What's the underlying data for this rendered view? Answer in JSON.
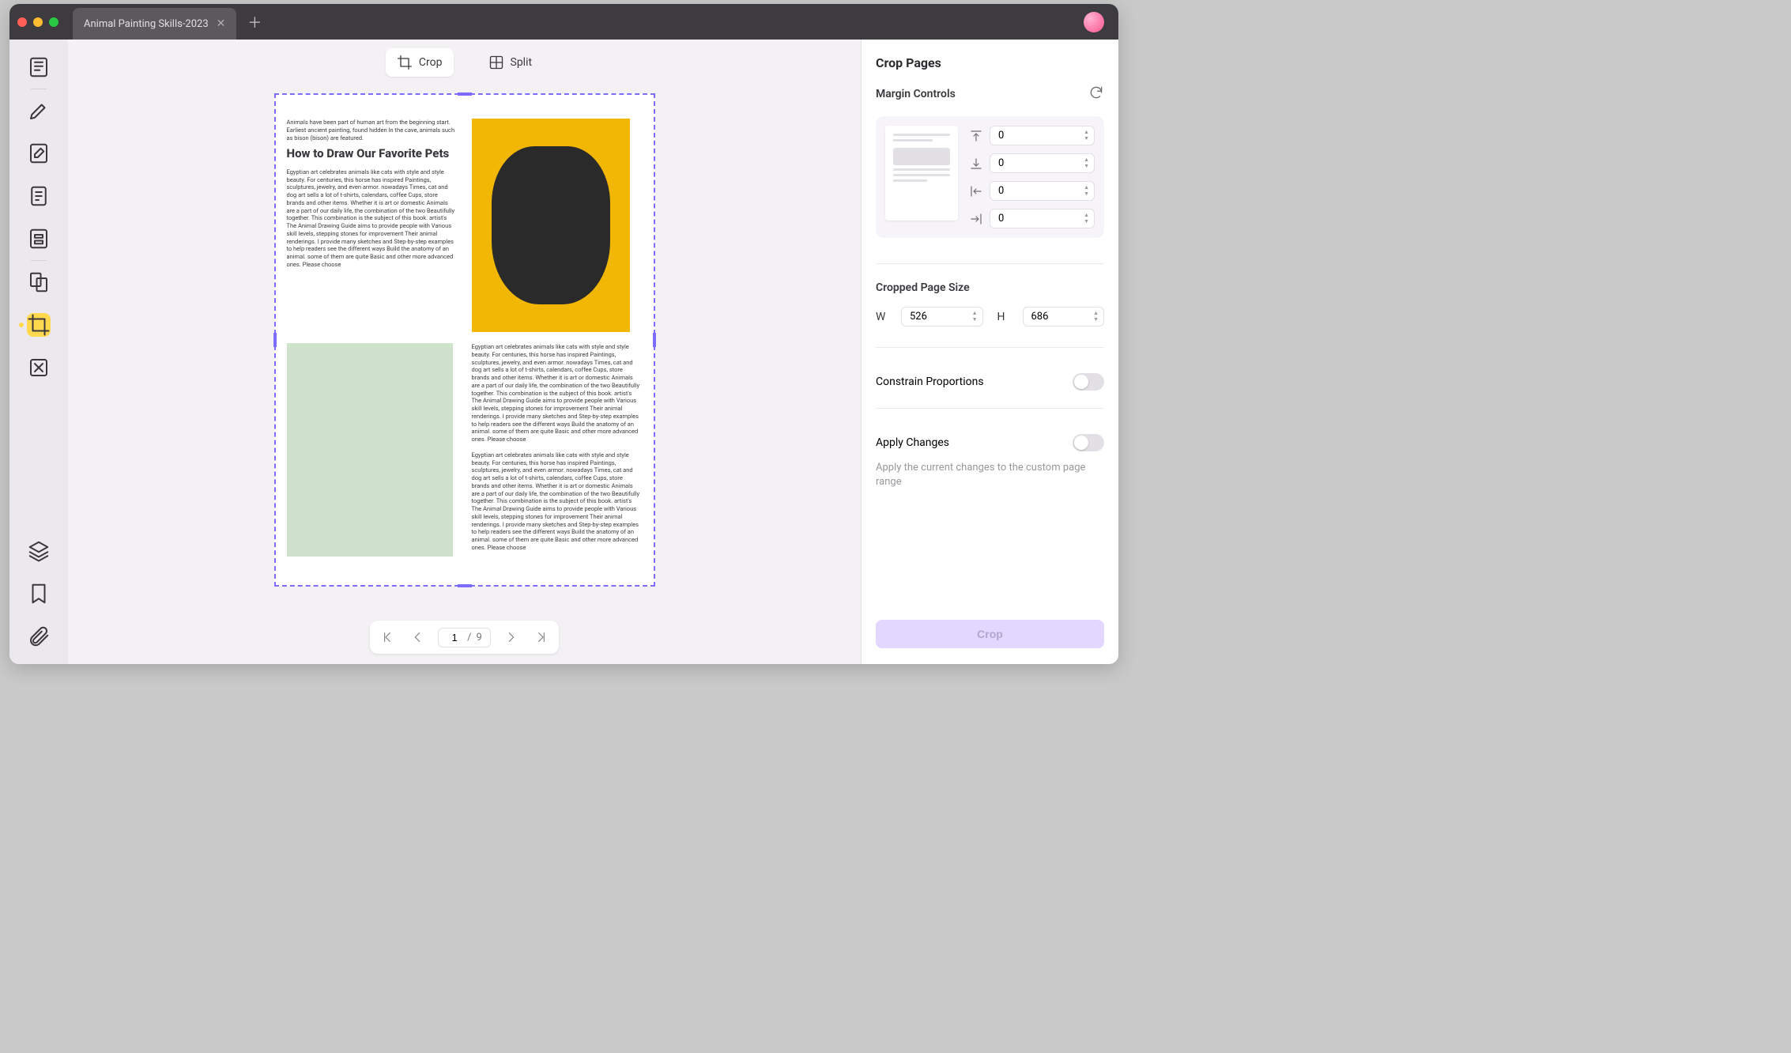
{
  "tab": {
    "title": "Animal Painting Skills-2023"
  },
  "toolbar": {
    "crop": "Crop",
    "split": "Split"
  },
  "doc": {
    "intro": "Animals have been part of human art from the beginning start. Earliest ancient painting, found hidden In the cave, animals such as bison (bison) are featured.",
    "heading": "How to Draw Our Favorite Pets",
    "body": "Egyptian art celebrates animals like cats with style and style beauty. For centuries, this horse has inspired Paintings, sculptures, jewelry, and even armor. nowadays Times, cat and dog art sells a lot of t-shirts, calendars, coffee Cups, store brands and other items. Whether it is art or domestic Animals are a part of our daily life, the combination of the two Beautifully together. This combination is the subject of this book. artist's The Animal Drawing Guide aims to provide people with Various skill levels, stepping stones for improvement Their animal renderings. I provide many sketches and Step-by-step examples to help readers see the different ways Build the anatomy of an animal. some of them are quite Basic and other more advanced ones. Please choose"
  },
  "pager": {
    "current": "1",
    "total": "9"
  },
  "panel": {
    "title": "Crop Pages",
    "margin_label": "Margin Controls",
    "margins": {
      "top": "0",
      "bottom": "0",
      "left": "0",
      "right": "0"
    },
    "size_label": "Cropped Page Size",
    "w_label": "W",
    "h_label": "H",
    "width": "526",
    "height": "686",
    "constrain_label": "Constrain Proportions",
    "apply_label": "Apply Changes",
    "apply_help": "Apply the current changes to the custom page range",
    "crop_btn": "Crop"
  }
}
